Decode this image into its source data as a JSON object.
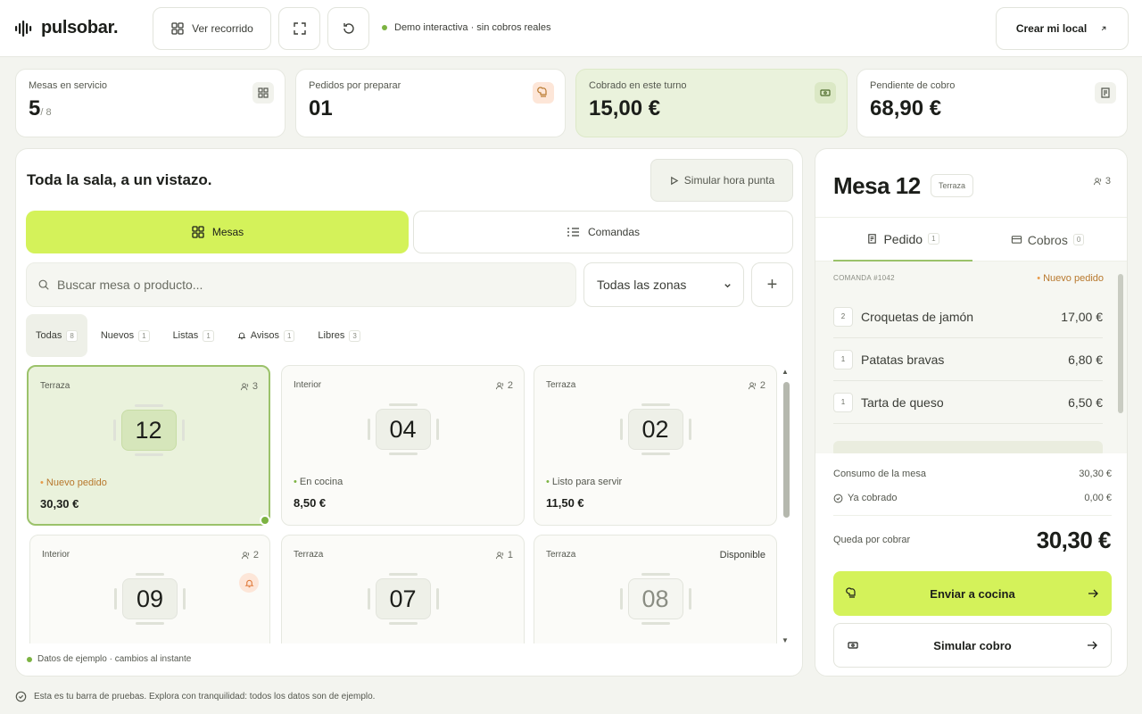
{
  "brand": {
    "name": "pulsobar."
  },
  "topbar": {
    "tour_label": "Ver recorrido",
    "demo_status": "Demo interactiva · sin cobros reales",
    "create_label": "Crear mi local"
  },
  "stats": [
    {
      "label": "Mesas en servicio",
      "value": "5",
      "suffix": "/ 8",
      "icon": "grid-icon"
    },
    {
      "label": "Pedidos por preparar",
      "value": "01",
      "icon": "chef-hat-icon"
    },
    {
      "label": "Cobrado en este turno",
      "value": "15,00 €",
      "icon": "cash-icon"
    },
    {
      "label": "Pendiente de cobro",
      "value": "68,90 €",
      "icon": "receipt-icon"
    }
  ],
  "main": {
    "title": "Toda la sala, a un vistazo.",
    "simulate_label": "Simular hora punta",
    "tabs": [
      {
        "label": "Mesas",
        "active": true,
        "icon": "grid-icon"
      },
      {
        "label": "Comandas",
        "active": false,
        "icon": "list-icon"
      }
    ],
    "search_placeholder": "Buscar mesa o producto...",
    "zone_select": "Todas las zonas",
    "filters": [
      {
        "label": "Todas",
        "count": "8",
        "active": true
      },
      {
        "label": "Nuevos",
        "count": "1"
      },
      {
        "label": "Listas",
        "count": "1"
      },
      {
        "label": "Avisos",
        "count": "1",
        "icon": "bell-icon"
      },
      {
        "label": "Libres",
        "count": "3"
      }
    ],
    "tables": [
      {
        "zone": "Terraza",
        "seats": "3",
        "number": "12",
        "status": "Nuevo pedido",
        "amount": "30,30 €",
        "selected": true
      },
      {
        "zone": "Interior",
        "seats": "2",
        "number": "04",
        "status": "En cocina",
        "amount": "8,50 €"
      },
      {
        "zone": "Terraza",
        "seats": "2",
        "number": "02",
        "status": "Listo para servir",
        "amount": "11,50 €"
      },
      {
        "zone": "Interior",
        "seats": "2",
        "number": "09",
        "alert": true
      },
      {
        "zone": "Terraza",
        "seats": "1",
        "number": "07"
      },
      {
        "zone": "Terraza",
        "number": "08",
        "availability": "Disponible"
      }
    ],
    "footnote": "Datos de ejemplo · cambios al instante"
  },
  "detail": {
    "title": "Mesa 12",
    "zone": "Terraza",
    "seats": "3",
    "tabs": [
      {
        "label": "Pedido",
        "count": "1",
        "active": true
      },
      {
        "label": "Cobros",
        "count": "0"
      }
    ],
    "comanda": "COMANDA #1042",
    "order_status": "Nuevo pedido",
    "items": [
      {
        "qty": "2",
        "name": "Croquetas de jamón",
        "price": "17,00 €"
      },
      {
        "qty": "1",
        "name": "Patatas bravas",
        "price": "6,80 €"
      },
      {
        "qty": "1",
        "name": "Tarta de queso",
        "price": "6,50 €"
      }
    ],
    "consumption_label": "Consumo de la mesa",
    "consumption_value": "30,30 €",
    "paid_label": "Ya cobrado",
    "paid_value": "0,00 €",
    "due_label": "Queda por cobrar",
    "due_value": "30,30 €",
    "send_label": "Enviar a cocina",
    "simulate_pay_label": "Simular cobro"
  },
  "footer": {
    "text": "Esta es tu barra de pruebas. Explora con tranquilidad: todos los datos son de ejemplo."
  },
  "colors": {
    "accent": "#d4f25a",
    "accent_soft": "#eaf2dc",
    "warn": "#e89b4a",
    "ok": "#7cb342"
  }
}
